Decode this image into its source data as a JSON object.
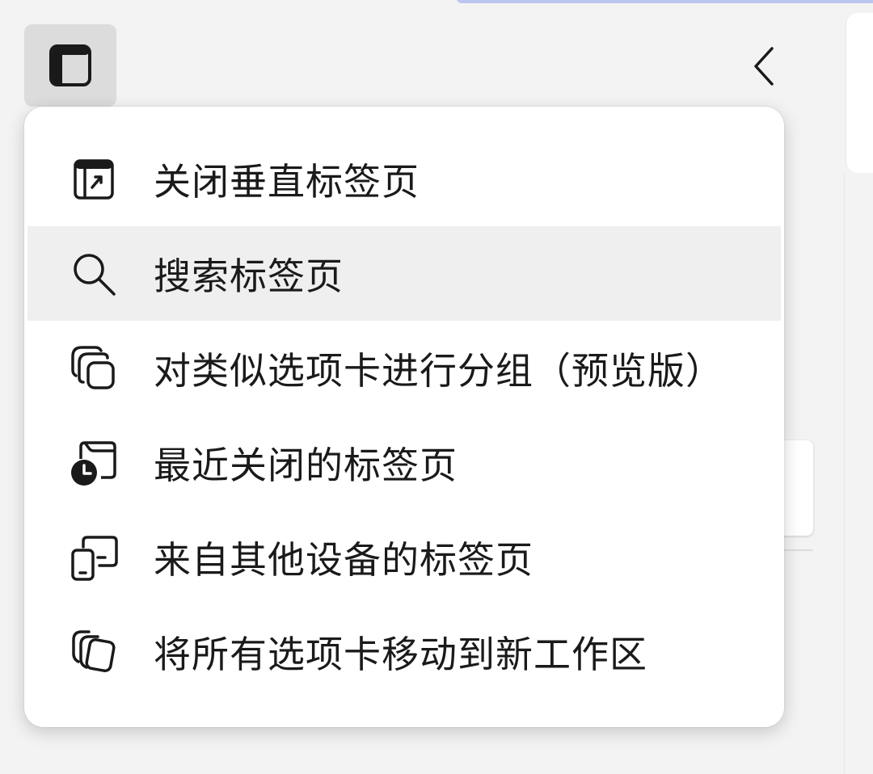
{
  "toolbar": {
    "layout_icon": "vertical-tabs-layout-icon",
    "collapse_icon": "chevron-left-icon"
  },
  "menu": {
    "highlight_color": "#efefef",
    "items": [
      {
        "label": "关闭垂直标签页",
        "icon": "close-vertical-tabs-icon"
      },
      {
        "label": "搜索标签页",
        "icon": "search-icon"
      },
      {
        "label": "对类似选项卡进行分组（预览版）",
        "icon": "group-tabs-icon"
      },
      {
        "label": "最近关闭的标签页",
        "icon": "recently-closed-icon"
      },
      {
        "label": "来自其他设备的标签页",
        "icon": "other-devices-icon"
      },
      {
        "label": "将所有选项卡移动到新工作区",
        "icon": "move-to-workspace-icon"
      }
    ]
  }
}
